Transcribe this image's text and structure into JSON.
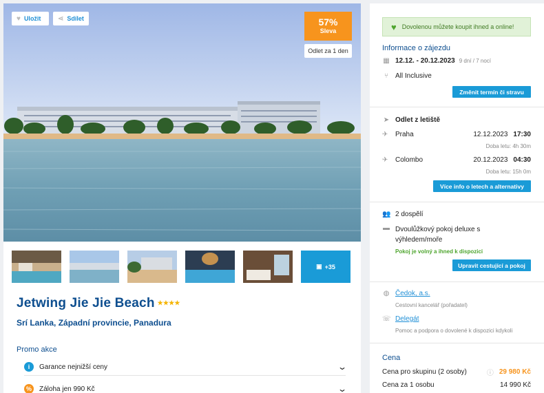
{
  "hero": {
    "save_label": "Uložit",
    "share_label": "Sdílet",
    "discount_pct": "57%",
    "discount_label": "Sleva",
    "depart_badge": "Odlet za 1 den"
  },
  "gallery": {
    "more_label": "+35"
  },
  "hotel": {
    "name": "Jetwing Jie Jie Beach",
    "stars": "★★★★",
    "location": "Srí Lanka, Západní provincie, Panadura"
  },
  "promo": {
    "title": "Promo akce",
    "items": [
      {
        "label": "Garance nejnižší ceny",
        "icon": "info-icon",
        "color": "#1a9bd7",
        "glyph": "i"
      },
      {
        "label": "Záloha jen 990 Kč",
        "icon": "percent-icon",
        "color": "#f7941d",
        "glyph": "%"
      }
    ]
  },
  "sidebar": {
    "notice": "Dovolenou můžete koupit ihned a online!",
    "trip_info_title": "Informace o zájezdu",
    "dates": "12.12. - 20.12.2023",
    "duration": "9 dní / 7 nocí",
    "board": "All Inclusive",
    "change_button": "Změnit termín či stravu",
    "departure_from": "Odlet z letiště",
    "flights": [
      {
        "city": "Praha",
        "date": "12.12.2023",
        "time": "17:30",
        "duration": "Doba letu: 4h 30m"
      },
      {
        "city": "Colombo",
        "date": "20.12.2023",
        "time": "04:30",
        "duration": "Doba letu: 15h 0m"
      }
    ],
    "flights_button": "Více info o letech a alternativy",
    "travellers": "2 dospělí",
    "room_line1": "Dvoulůžkový pokoj deluxe s",
    "room_line2": "výhledem/moře",
    "room_available": "Pokoj je volný a ihned k dispozici",
    "travellers_button": "Upravit cestující a pokoj",
    "agency_name": "Čedok, a.s.",
    "agency_desc": "Cestovní kancelář (pořadatel)",
    "delegate": "Delegát",
    "delegate_desc": "Pomoc a podpora o dovolené k dispozici kdykoli",
    "price_title": "Cena",
    "price_group_label": "Cena pro skupinu (2 osoby)",
    "price_group_value": "29 980 Kč",
    "price_person_label": "Cena za 1 osobu",
    "price_person_value": "14 990 Kč"
  },
  "colors": {
    "accent_blue": "#1a9bd7",
    "title_blue": "#0d4e8f",
    "discount_orange": "#f7941d",
    "success_green": "#4ea52e"
  }
}
